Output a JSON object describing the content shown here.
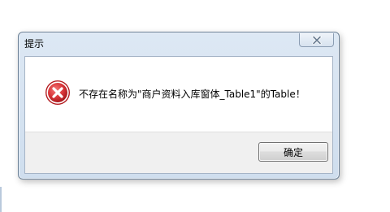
{
  "dialog": {
    "title": "提示",
    "close_icon": "close-icon",
    "message": "不存在名称为\"商户资料入库窗体_Table1\"的Table！",
    "icon": "error-icon",
    "ok_label": "确定"
  },
  "colors": {
    "error_red": "#d9363a",
    "frame": "#6b8096",
    "footer": "#f0f0f0"
  }
}
